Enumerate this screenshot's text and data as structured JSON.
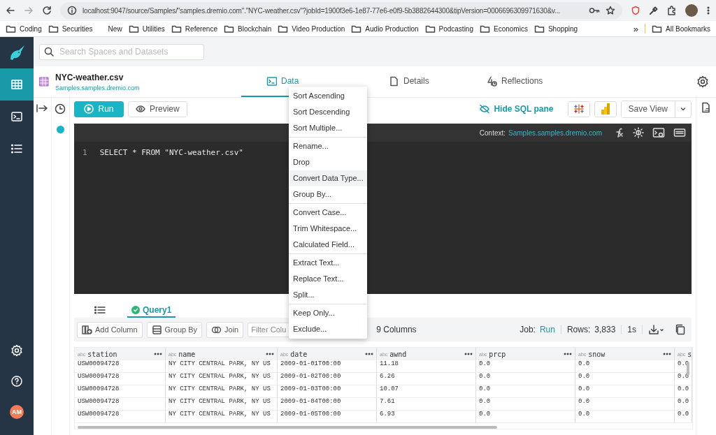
{
  "browser": {
    "url": "localhost:9047/source/Samples/\"samples.dremio.com\".\"NYC-weather.csv\"?jobId=1900f3e6-1e87-77e6-e0f9-5b3882644300&tipVersion=0006696309971630&v...",
    "bookmarks": [
      {
        "label": "Coding",
        "kind": "folder"
      },
      {
        "label": "Securities",
        "kind": "folder"
      },
      {
        "label": "New",
        "kind": "page"
      },
      {
        "label": "Utilities",
        "kind": "folder"
      },
      {
        "label": "Reference",
        "kind": "folder"
      },
      {
        "label": "Blockchain",
        "kind": "folder"
      },
      {
        "label": "Video Production",
        "kind": "folder"
      },
      {
        "label": "Audio Production",
        "kind": "folder"
      },
      {
        "label": "Podcasting",
        "kind": "folder"
      },
      {
        "label": "Economics",
        "kind": "folder"
      },
      {
        "label": "Shopping",
        "kind": "folder"
      }
    ],
    "overflow": "»",
    "all_bookmarks": "All Bookmarks"
  },
  "search": {
    "placeholder": "Search Spaces and Datasets"
  },
  "nav": {
    "items": [
      {
        "kind": "grid",
        "selected": true
      },
      {
        "kind": "terminal",
        "selected": false
      },
      {
        "kind": "list",
        "selected": false
      }
    ],
    "avatar": "AM"
  },
  "dataset": {
    "name": "NYC-weather.csv",
    "path": "Samples.samples.dremio.com"
  },
  "tabs": [
    {
      "label": "Data",
      "kind": "data",
      "selected": true
    },
    {
      "label": "Details",
      "kind": "details",
      "selected": false
    },
    {
      "label": "Reflections",
      "kind": "reflections",
      "selected": false
    }
  ],
  "toolbar": {
    "run": "Run",
    "preview": "Preview",
    "hide_sql": "Hide SQL pane",
    "save": "Save View"
  },
  "editor": {
    "lines": [
      {
        "number": "1",
        "code": "SELECT * FROM \"NYC-weather.csv\""
      }
    ],
    "context_label": "Context:",
    "context": "Samples.samples.dremio.com"
  },
  "results": {
    "tabs": [
      {
        "label": "Query1",
        "selected": true
      }
    ],
    "actions": [
      {
        "label": "Add Column",
        "kind": "add"
      },
      {
        "label": "Group By",
        "kind": "group"
      },
      {
        "label": "Join",
        "kind": "join"
      }
    ],
    "filter": {
      "placeholder": "Filter Colu"
    },
    "column_count": "9 Columns",
    "job_label": "Job:",
    "job": "Run",
    "rows_label": "Rows:",
    "rows": "3,833",
    "duration": "1s"
  },
  "table": {
    "columns": [
      {
        "name": "station",
        "type": "abc"
      },
      {
        "name": "name",
        "type": "abc"
      },
      {
        "name": "date",
        "type": "abc"
      },
      {
        "name": "awnd",
        "type": "abc"
      },
      {
        "name": "prcp",
        "type": "abc"
      },
      {
        "name": "snow",
        "type": "abc"
      },
      {
        "name": "s",
        "type": "abc"
      }
    ],
    "rows": [
      [
        "USW00094728",
        "NY CITY CENTRAL PARK, NY US",
        "2009-01-01T00:00",
        "11.18",
        "0.0",
        "0.0",
        "0.0"
      ],
      [
        "USW00094728",
        "NY CITY CENTRAL PARK, NY US",
        "2009-01-02T00:00",
        "6.26",
        "0.0",
        "0.0",
        "0.0"
      ],
      [
        "USW00094728",
        "NY CITY CENTRAL PARK, NY US",
        "2009-01-03T00:00",
        "10.07",
        "0.0",
        "0.0",
        "0.0"
      ],
      [
        "USW00094728",
        "NY CITY CENTRAL PARK, NY US",
        "2009-01-04T00:00",
        "7.61",
        "0.0",
        "0.0",
        "0.0"
      ],
      [
        "USW00094728",
        "NY CITY CENTRAL PARK, NY US",
        "2009-01-05T00:00",
        "6.93",
        "0.0",
        "0.0",
        "0.0"
      ]
    ]
  },
  "menu": {
    "sections": [
      [
        {
          "label": "Sort Ascending",
          "selected": false
        },
        {
          "label": "Sort Descending",
          "selected": false
        },
        {
          "label": "Sort Multiple...",
          "selected": false
        }
      ],
      [
        {
          "label": "Rename...",
          "selected": false
        },
        {
          "label": "Drop",
          "selected": false
        },
        {
          "label": "Convert Data Type...",
          "selected": true
        },
        {
          "label": "Group By...",
          "selected": false
        }
      ],
      [
        {
          "label": "Convert Case...",
          "selected": false
        },
        {
          "label": "Trim Whitespace...",
          "selected": false
        },
        {
          "label": "Calculated Field...",
          "selected": false
        }
      ],
      [
        {
          "label": "Extract Text...",
          "selected": false
        },
        {
          "label": "Replace Text...",
          "selected": false
        },
        {
          "label": "Split...",
          "selected": false
        }
      ],
      [
        {
          "label": "Keep Only...",
          "selected": false
        },
        {
          "label": "Exclude...",
          "selected": false
        }
      ]
    ]
  }
}
